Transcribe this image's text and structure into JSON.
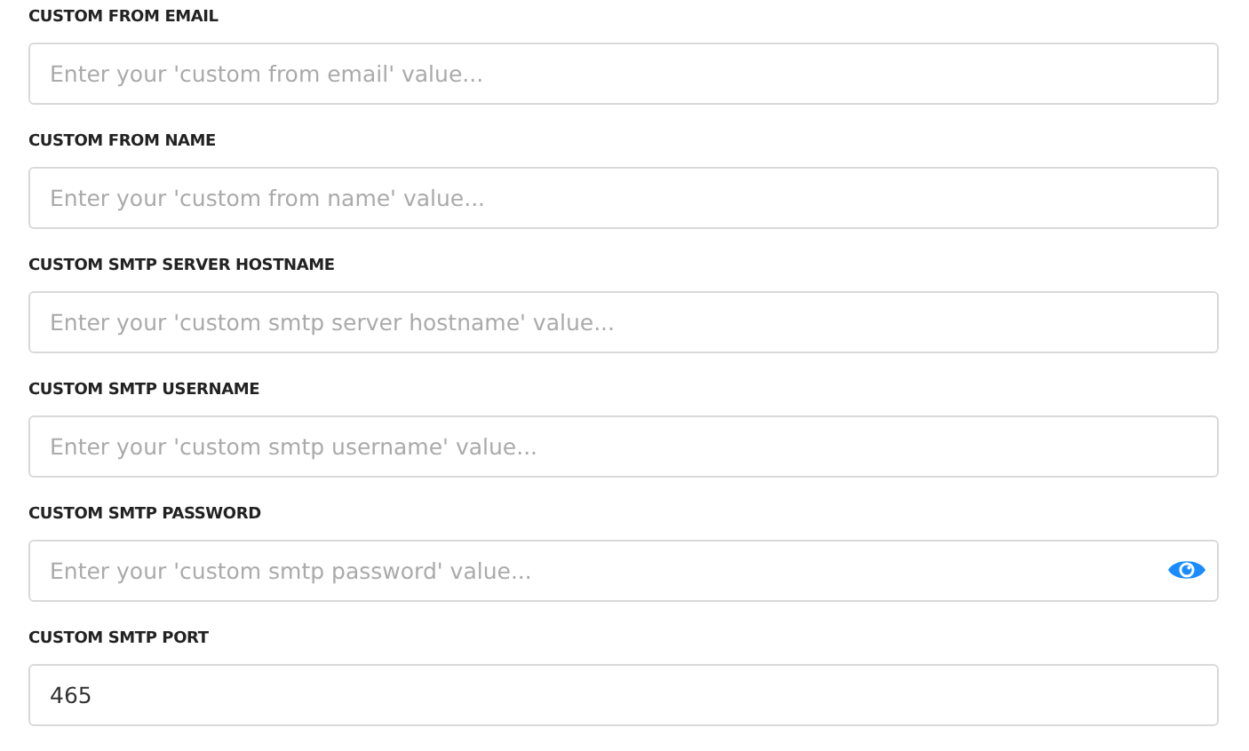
{
  "fields": [
    {
      "label": "CUSTOM FROM EMAIL",
      "kind": "text",
      "placeholder": "Enter your 'custom from email' value..."
    },
    {
      "label": "CUSTOM FROM NAME",
      "kind": "text",
      "placeholder": "Enter your 'custom from name' value..."
    },
    {
      "label": "CUSTOM SMTP SERVER HOSTNAME",
      "kind": "text",
      "placeholder": "Enter your 'custom smtp server hostname' value..."
    },
    {
      "label": "CUSTOM SMTP USERNAME",
      "kind": "text",
      "placeholder": "Enter your 'custom smtp username' value..."
    },
    {
      "label": "CUSTOM SMTP PASSWORD",
      "kind": "password",
      "placeholder": "Enter your 'custom smtp password' value..."
    },
    {
      "label": "CUSTOM SMTP PORT",
      "kind": "text",
      "value": "465"
    }
  ]
}
